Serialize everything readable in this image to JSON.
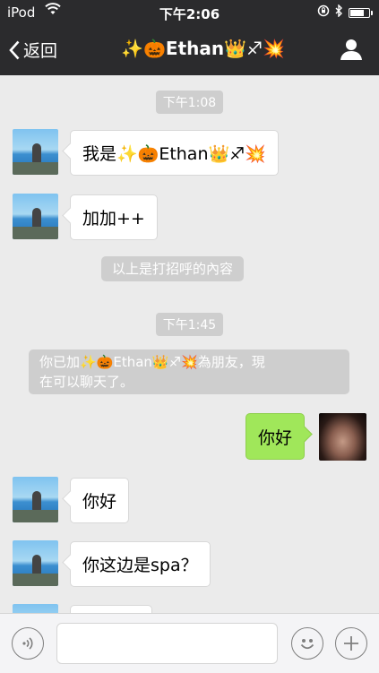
{
  "status_bar": {
    "carrier": "iPod",
    "time": "下午2:06",
    "battery_level": 0.8
  },
  "nav": {
    "back_label": "返回",
    "title": "✨🎃Ethan👑♐💥"
  },
  "messages": {
    "ts1": "下午1:08",
    "m1": "我是✨🎃Ethan👑♐💥",
    "m2": "加加++",
    "sys1": "以上是打招呼的內容",
    "ts2": "下午1:45",
    "sys2_line1": "你已加✨🎃Ethan👑♐💥為朋友，現",
    "sys2_line2": "在可以聊天了。",
    "m3": "你好",
    "m4": "你好",
    "m5": "你这边是spa？"
  },
  "input": {
    "placeholder": ""
  },
  "colors": {
    "bar": "#2b2b2d",
    "chat_bg": "#ebebeb",
    "my_bubble": "#a0e75a",
    "sys_bubble": "#cecece"
  }
}
